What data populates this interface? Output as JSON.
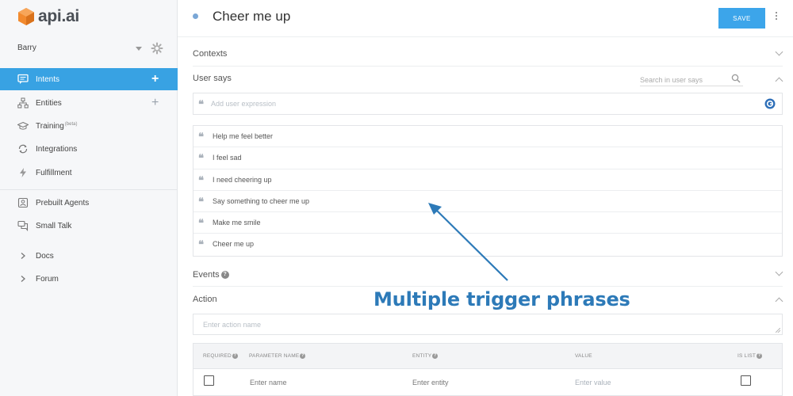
{
  "app": {
    "logo_text": "api.ai",
    "accent": "#38a2e3",
    "logo_color": "#f28a2e"
  },
  "agent": {
    "name": "Barry"
  },
  "sidebar": {
    "items": [
      {
        "label": "Intents",
        "icon": "chat-icon",
        "active": true,
        "plus": "+"
      },
      {
        "label": "Entities",
        "icon": "hierarchy-icon",
        "plus": "+"
      },
      {
        "label": "Training",
        "badge": "(beta)",
        "icon": "graduation-cap-icon"
      },
      {
        "label": "Integrations",
        "icon": "sync-icon"
      },
      {
        "label": "Fulfillment",
        "icon": "lightning-icon"
      },
      {
        "label": "Prebuilt Agents",
        "icon": "agent-icon"
      },
      {
        "label": "Small Talk",
        "icon": "chat-bubbles-icon"
      },
      {
        "label": "Docs",
        "icon": "chevron-right-icon"
      },
      {
        "label": "Forum",
        "icon": "chevron-right-icon"
      }
    ]
  },
  "header": {
    "title": "Cheer me up",
    "save_label": "SAVE"
  },
  "main": {
    "contexts_label": "Contexts",
    "user_says_label": "User says",
    "search_placeholder": "Search in user says",
    "expression_placeholder": "Add user expression",
    "user_says": [
      "Help me feel better",
      "I feel sad",
      "I need cheering up",
      "Say something to cheer me up",
      "Make me smile",
      "Cheer me up"
    ],
    "events_label": "Events",
    "action_label": "Action",
    "action_placeholder": "Enter action name",
    "params": {
      "columns": [
        "REQUIRED",
        "PARAMETER NAME",
        "ENTITY",
        "VALUE",
        "IS LIST"
      ],
      "name_placeholder": "Enter name",
      "entity_placeholder": "Enter entity",
      "value_placeholder": "Enter value"
    }
  },
  "annotation": {
    "text": "Multiple trigger phrases",
    "color": "#2d7ab8"
  }
}
